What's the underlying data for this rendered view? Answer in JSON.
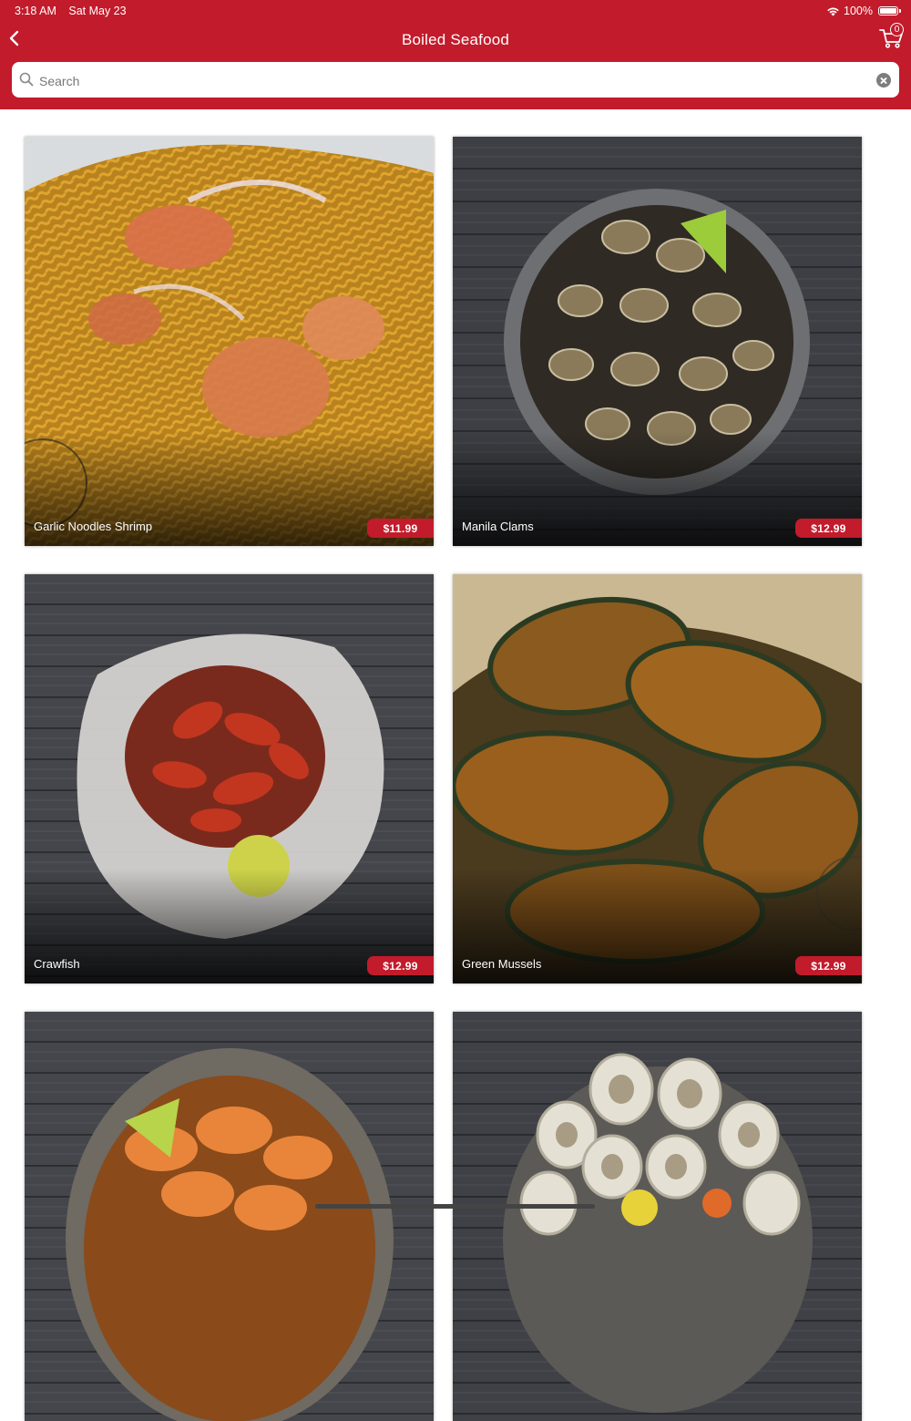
{
  "status_bar": {
    "time": "3:18 AM",
    "date": "Sat May 23",
    "battery": "100%"
  },
  "header": {
    "title": "Boiled Seafood",
    "cart_count": "0"
  },
  "search": {
    "placeholder": "Search",
    "value": ""
  },
  "items": [
    {
      "name": "Garlic Noodles Shrimp",
      "price": "$11.99"
    },
    {
      "name": "Manila Clams",
      "price": "$12.99"
    },
    {
      "name": "Crawfish",
      "price": "$12.99"
    },
    {
      "name": "Green Mussels",
      "price": "$12.99"
    },
    {
      "name": "",
      "price": ""
    },
    {
      "name": "",
      "price": ""
    }
  ],
  "colors": {
    "brand": "#c21b2b",
    "background": "#ffffff"
  }
}
